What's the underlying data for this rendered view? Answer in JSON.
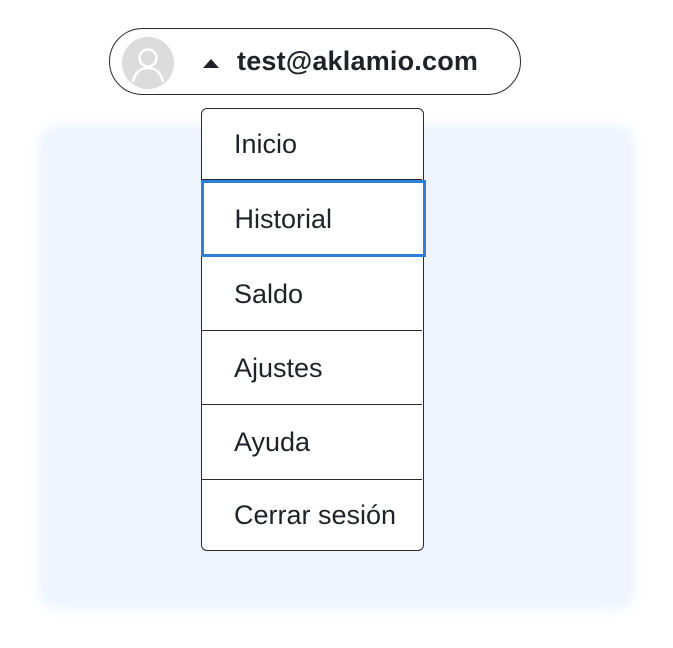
{
  "account": {
    "email": "test@aklamio.com",
    "avatar_icon": "user-avatar-icon",
    "caret_icon": "caret-up-icon"
  },
  "menu": {
    "items": [
      {
        "label": "Inicio"
      },
      {
        "label": "Historial",
        "active": true
      },
      {
        "label": "Saldo"
      },
      {
        "label": "Ajustes"
      },
      {
        "label": "Ayuda"
      },
      {
        "label": "Cerrar sesión"
      }
    ],
    "active_border_color": "#2e7fd9"
  },
  "colors": {
    "background_panel": "#eef5ff",
    "avatar_bg": "#dcdcdc",
    "border": "#2b2b2b"
  }
}
